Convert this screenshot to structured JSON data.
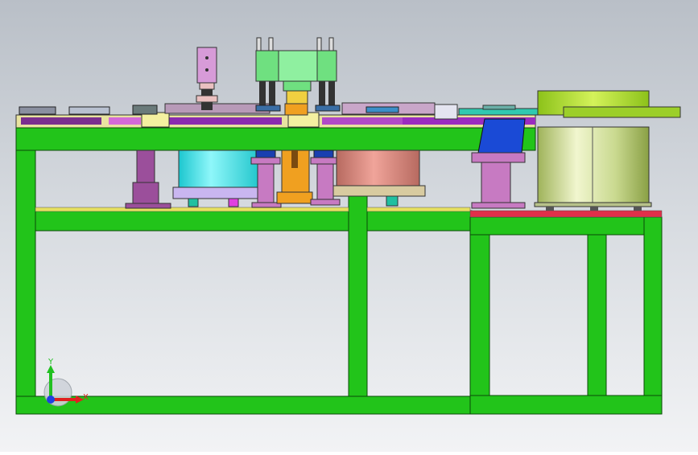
{
  "viewport": {
    "background": "gradient-grey",
    "colors": {
      "frame_green": "#22c41a",
      "frame_outline": "#0b4a08",
      "cyan_cylinder": "#29e0e6",
      "salmon_cylinder": "#d98a80",
      "vibratory_bowl": "#c2d67a",
      "purple_base": "#9b59b6",
      "pink_block": "#c77ac2",
      "orange_part": "#f0a020",
      "blue_chute": "#1a4ad6",
      "red_plate": "#e0304a",
      "yellow_rail": "#e6e060"
    }
  },
  "axis_triad": {
    "x_label": "X",
    "y_label": "Y",
    "x_color": "#e02020",
    "y_color": "#20c020",
    "origin_color": "#2040e0"
  }
}
